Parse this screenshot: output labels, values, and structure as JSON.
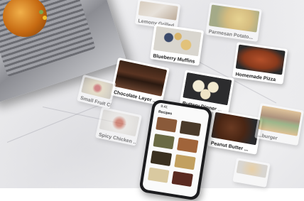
{
  "phone": {
    "status_time": "9:41",
    "title": "Recipes"
  },
  "cards": {
    "lemony": "Lemony Grilled...",
    "parmesan": "Parmesan Potato...",
    "blueberry": "Blueberry Muffins",
    "pizza": "Homemade Pizza",
    "chocolate": "Chocolate Layer ...",
    "smallfruit": "Small Fruit Chee...",
    "buttery": "Buttery Dinner ...",
    "spicy": "Spicy Chicken ...",
    "peanut": "Peanut Butter ...",
    "burger": "...burger",
    "bottom": ""
  },
  "colors": {
    "marble": "#efeff1",
    "phone_body": "#1c1c1e",
    "card_bg": "#ffffff"
  }
}
